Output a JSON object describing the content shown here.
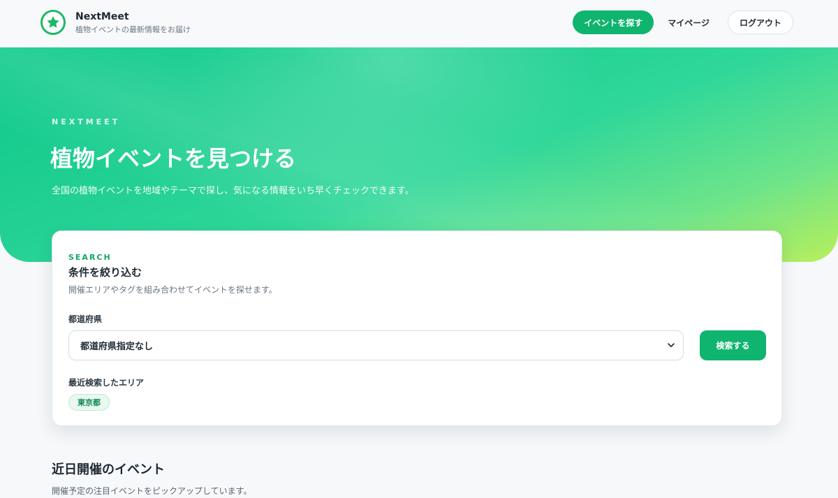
{
  "header": {
    "brand_name": "NextMeet",
    "brand_tagline": "植物イベントの最新情報をお届け",
    "nav": {
      "find_events": "イベントを探す",
      "my_page": "マイページ",
      "logout": "ログアウト"
    }
  },
  "hero": {
    "eyebrow": "NEXTMEET",
    "title": "植物イベントを見つける",
    "subtitle": "全国の植物イベントを地域やテーマで探し、気になる情報をいち早くチェックできます。"
  },
  "search": {
    "eyebrow": "SEARCH",
    "title": "条件を絞り込む",
    "description": "開催エリアやタグを組み合わせてイベントを探せます。",
    "prefecture_label": "都道府県",
    "prefecture_value": "都道府県指定なし",
    "submit_label": "検索する",
    "recent_label": "最近検索したエリア",
    "recent_chips": [
      "東京都"
    ]
  },
  "upcoming": {
    "title": "近日開催のイベント",
    "description": "開催予定の注目イベントをピックアップしています。"
  },
  "colors": {
    "brand": "#0fb46e",
    "accent_text": "#12a567"
  }
}
